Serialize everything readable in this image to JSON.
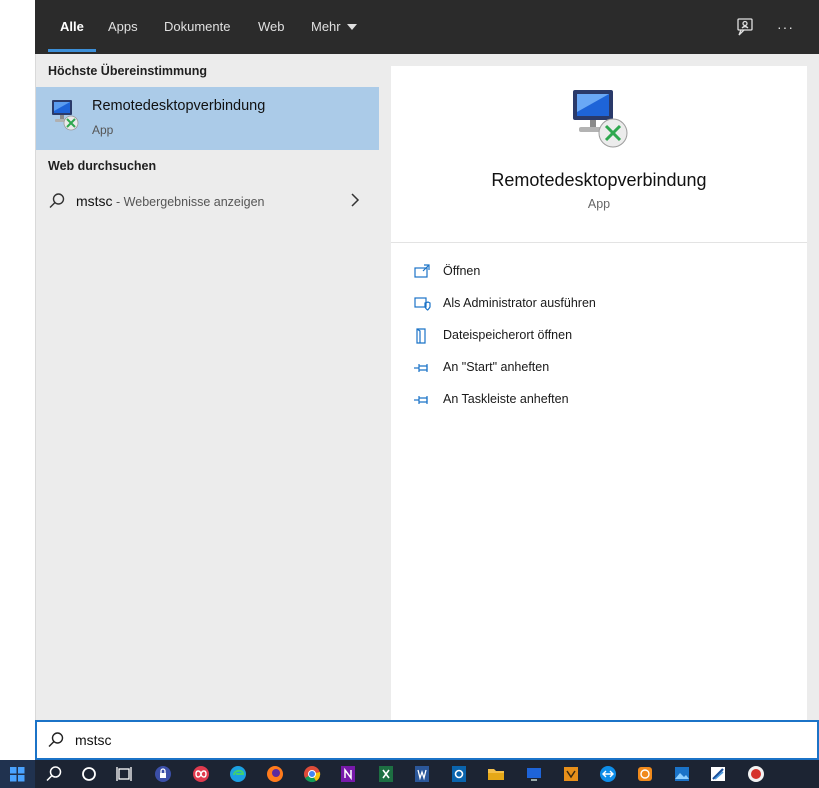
{
  "tabs": [
    {
      "label": "Alle",
      "active": true
    },
    {
      "label": "Apps",
      "active": false
    },
    {
      "label": "Dokumente",
      "active": false
    },
    {
      "label": "Web",
      "active": false
    },
    {
      "label": "Mehr",
      "active": false
    }
  ],
  "top_icons": [
    "feedback-icon",
    "more-options-icon"
  ],
  "top_icons_glyph": {
    "more": "···"
  },
  "left": {
    "best_match_title": "Höchste Übereinstimmung",
    "best_match": {
      "name": "Remotedesktopverbindung",
      "type": "App"
    },
    "web_title": "Web durchsuchen",
    "web_result": {
      "query": "mstsc",
      "hint": " - Webergebnisse anzeigen"
    }
  },
  "detail": {
    "name": "Remotedesktopverbindung",
    "type": "App",
    "actions": [
      {
        "label": "Öffnen",
        "icon": "open-icon"
      },
      {
        "label": "Als Administrator ausführen",
        "icon": "admin-shield-icon"
      },
      {
        "label": "Dateispeicherort öffnen",
        "icon": "file-location-icon"
      },
      {
        "label": "An \"Start\" anheften",
        "icon": "pin-icon"
      },
      {
        "label": "An Taskleiste anheften",
        "icon": "pin-icon"
      }
    ]
  },
  "search": {
    "value": "mstsc"
  },
  "colors": {
    "topbar": "#2b2b2b",
    "accent": "#1b73c7",
    "selection": "#abcbe8",
    "taskbar": "#1c2433"
  },
  "taskbar_items": [
    "windows-start-icon",
    "search-icon",
    "cortana-icon",
    "task-view-icon",
    "keepass-icon",
    "infinity-app-icon",
    "edge-icon",
    "firefox-icon",
    "chrome-icon",
    "onenote-icon",
    "excel-icon",
    "word-icon",
    "outlook-icon",
    "file-explorer-icon",
    "remote-desktop-icon",
    "app-orange-icon",
    "teamviewer-icon",
    "app-sync-icon",
    "photos-icon",
    "app-checkmark-icon",
    "app-red-icon"
  ]
}
